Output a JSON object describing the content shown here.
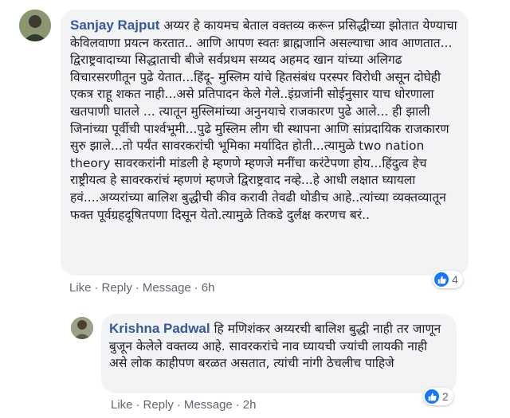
{
  "comments": [
    {
      "author": "Sanjay Rajput",
      "text": "अय्यर हे कायमच बेताल वक्तव्य करून प्रसिद्धीच्या झोतात येण्याचा केविलवाणा प्रयत्न करतात.. आणि आपण स्वतः ब्राह्मजानि असल्याचा आव आणतात... द्विराष्ट्रवादाच्या सिद्धाताची बीजे सर्वप्रथम सय्यद अहमद खान यांच्या अलिगढ विचारसरणीतून पुढे येतात...हिंदू- मुस्लिम यांचे हितसंबंध परस्पर विरोधी असून दोघेही एकत्र राहू शकत नाही...असे प्रतिपादन केले गेले..इंग्रजांनी सोईनुसार याच धोरणाला खतपाणी घातले ... त्यातून मुस्लिमांच्या अनुनयाचे राजकारण पुढे आले... ही झाली जिनांच्या पूर्वीची पार्श्वभूमी...पुढे मुस्लिम लीग ची स्थापना आणि सांप्रदायिक राजकारण सुरु झाले...तो पर्यंत सावरकरांची भूमिका मर्यादित होती...त्यामुळे two nation theory सावरकरांनी मांडली हे म्हणणे म्हणजे मनींचा करंटेपणा होय...हिंदुत्व हेच राष्ट्रीयत्व हे सावरकरांचं म्हणणं म्हणजे द्विराष्ट्रवाद नव्हे...हे आधी लक्षात घ्यायला हवं....अय्यरांच्या बालिश बुद्धीची कीव करावी तेवढी थोडीच आहे..त्यांच्या व्यक्तव्यातून फक्त पूर्वग्रहदूषितपणा दिसून येतो.त्यामुळे तिकडे दुर्लक्ष करणच बरं..",
      "actions": {
        "like": "Like",
        "reply": "Reply",
        "message": "Message",
        "time": "6h",
        "sep": "·"
      },
      "reaction_count": "4"
    },
    {
      "author": "Krishna Padwal",
      "text": "हि मणिशंकर अय्यरची बालिश बुद्धी नाही तर जाणून बुजून केलेले वक्तव्य आहे. सावरकरांचे नाव घ्यायची ज्यांची लायकी नाही असे लोक काहीपण बरळत असतात, त्यांची नांगी ठेचलीच पाहिजे",
      "actions": {
        "like": "Like",
        "reply": "Reply",
        "message": "Message",
        "time": "2h",
        "sep": "·"
      },
      "reaction_count": "2"
    }
  ],
  "icons": {
    "reaction": "like-thumb-icon"
  },
  "colors": {
    "author": "#385898",
    "bubble": "#f2f3f5",
    "like_badge": "#1877f2",
    "meta": "#606770"
  }
}
